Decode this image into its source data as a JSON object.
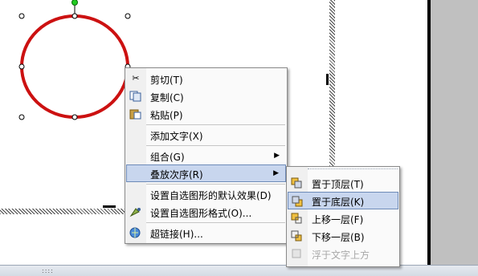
{
  "colors": {
    "shape_outline": "#cc1111",
    "highlight": "#c8d6ee",
    "highlight_border": "#6e8bb8"
  },
  "context_menu": {
    "items": [
      {
        "label": "剪切(T)",
        "icon": "scissors-icon"
      },
      {
        "label": "复制(C)",
        "icon": "copy-icon"
      },
      {
        "label": "粘贴(P)",
        "icon": "paste-icon"
      },
      {
        "label": "添加文字(X)"
      },
      {
        "label": "组合(G)",
        "submenu": true
      },
      {
        "label": "叠放次序(R)",
        "submenu": true,
        "highlighted": true
      },
      {
        "label": "设置自选图形的默认效果(D)"
      },
      {
        "label": "设置自选图形格式(O)...",
        "icon": "format-shape-icon"
      },
      {
        "label": "超链接(H)...",
        "icon": "hyperlink-icon"
      }
    ]
  },
  "order_submenu": {
    "items": [
      {
        "label": "置于顶层(T)",
        "icon": "bring-to-front-icon"
      },
      {
        "label": "置于底层(K)",
        "icon": "send-to-back-icon",
        "highlighted": true
      },
      {
        "label": "上移一层(F)",
        "icon": "bring-forward-icon"
      },
      {
        "label": "下移一层(B)",
        "icon": "send-backward-icon"
      },
      {
        "label": "浮于文字上方",
        "icon": "float-above-text-icon",
        "disabled": true
      }
    ]
  }
}
